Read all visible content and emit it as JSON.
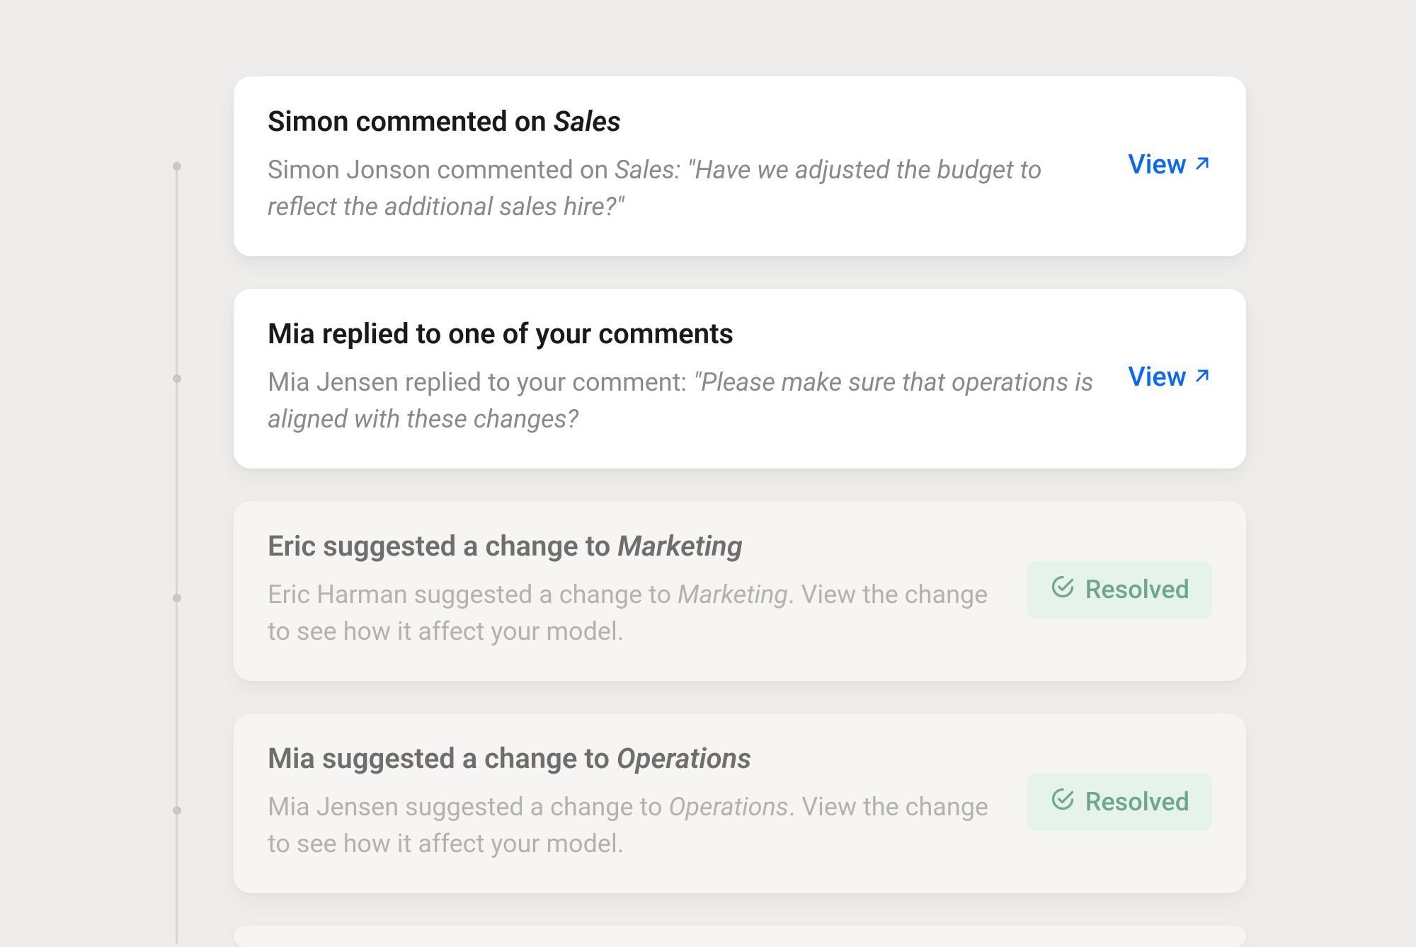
{
  "view_label": "View",
  "resolved_label": "Resolved",
  "items": [
    {
      "title_pre": "Simon commented on ",
      "title_em": "Sales",
      "body_pre": "Simon Jonson commented on ",
      "body_em": "Sales: \"Have we adjusted the budget to reflect the additional sales hire?\"",
      "body_post": "",
      "action": "view",
      "variant": "primary"
    },
    {
      "title_pre": "Mia replied to one of your comments",
      "title_em": "",
      "body_pre": "Mia Jensen replied to your comment: ",
      "body_em": "\"Please make sure that operations is aligned with these changes?",
      "body_post": "",
      "action": "view",
      "variant": "primary"
    },
    {
      "title_pre": "Eric suggested a change to ",
      "title_em": "Marketing",
      "body_pre": "Eric Harman suggested a change to ",
      "body_em": "Marketing",
      "body_post": ". View the change to see how it affect your model.",
      "action": "resolved",
      "variant": "muted"
    },
    {
      "title_pre": "Mia suggested a change to ",
      "title_em": "Operations",
      "body_pre": "Mia Jensen suggested a change to ",
      "body_em": "Operations",
      "body_post": ". View the change to see how it affect your model.",
      "action": "resolved",
      "variant": "muted"
    }
  ]
}
